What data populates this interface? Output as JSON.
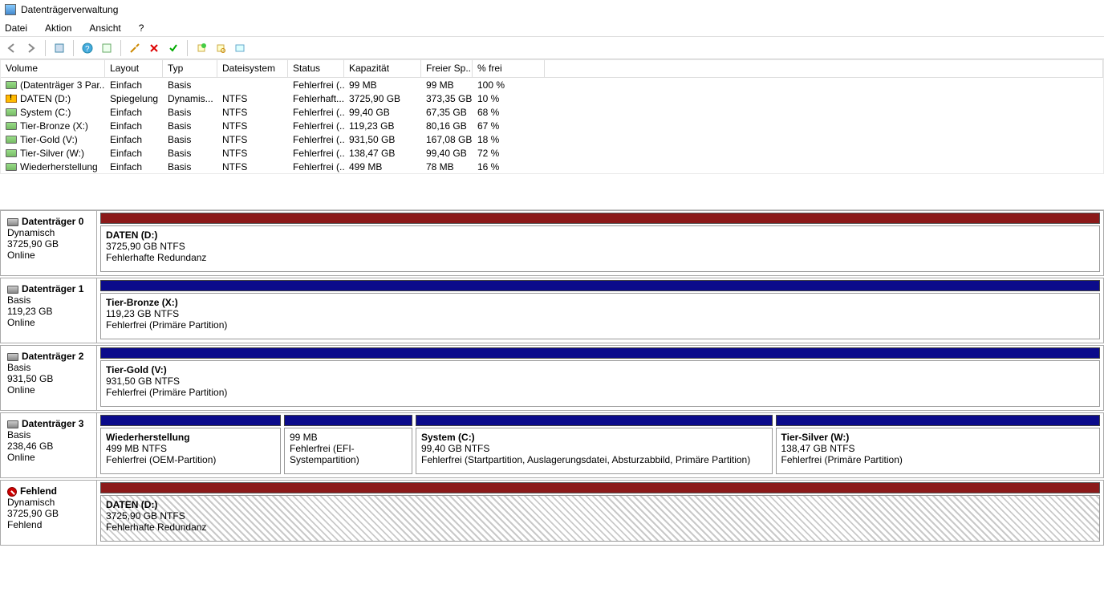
{
  "window": {
    "title": "Datenträgerverwaltung"
  },
  "menu": {
    "file": "Datei",
    "action": "Aktion",
    "view": "Ansicht",
    "help": "?"
  },
  "columns": {
    "volume": "Volume",
    "layout": "Layout",
    "typ": "Typ",
    "fs": "Dateisystem",
    "status": "Status",
    "cap": "Kapazität",
    "free": "Freier Sp...",
    "pct": "% frei"
  },
  "volumes": [
    {
      "name": "(Datenträger 3 Par...",
      "layout": "Einfach",
      "typ": "Basis",
      "fs": "",
      "status": "Fehlerfrei (...",
      "cap": "99 MB",
      "free": "99 MB",
      "pct": "100 %",
      "icon": "ico-vol"
    },
    {
      "name": "DATEN (D:)",
      "layout": "Spiegelung",
      "typ": "Dynamis...",
      "fs": "NTFS",
      "status": "Fehlerhaft...",
      "cap": "3725,90 GB",
      "free": "373,35 GB",
      "pct": "10 %",
      "icon": "ico-warn"
    },
    {
      "name": "System (C:)",
      "layout": "Einfach",
      "typ": "Basis",
      "fs": "NTFS",
      "status": "Fehlerfrei (...",
      "cap": "99,40 GB",
      "free": "67,35 GB",
      "pct": "68 %",
      "icon": "ico-vol"
    },
    {
      "name": "Tier-Bronze (X:)",
      "layout": "Einfach",
      "typ": "Basis",
      "fs": "NTFS",
      "status": "Fehlerfrei (...",
      "cap": "119,23 GB",
      "free": "80,16 GB",
      "pct": "67 %",
      "icon": "ico-vol"
    },
    {
      "name": "Tier-Gold (V:)",
      "layout": "Einfach",
      "typ": "Basis",
      "fs": "NTFS",
      "status": "Fehlerfrei (...",
      "cap": "931,50 GB",
      "free": "167,08 GB",
      "pct": "18 %",
      "icon": "ico-vol"
    },
    {
      "name": "Tier-Silver (W:)",
      "layout": "Einfach",
      "typ": "Basis",
      "fs": "NTFS",
      "status": "Fehlerfrei (...",
      "cap": "138,47 GB",
      "free": "99,40 GB",
      "pct": "72 %",
      "icon": "ico-vol"
    },
    {
      "name": "Wiederherstellung",
      "layout": "Einfach",
      "typ": "Basis",
      "fs": "NTFS",
      "status": "Fehlerfrei (...",
      "cap": "499 MB",
      "free": "78 MB",
      "pct": "16 %",
      "icon": "ico-vol"
    }
  ],
  "disks": [
    {
      "name": "Datenträger 0",
      "type": "Dynamisch",
      "size": "3725,90 GB",
      "status": "Online",
      "band": "band-red",
      "icon": "dico",
      "parts": [
        {
          "title": "DATEN  (D:)",
          "line2": "3725,90 GB NTFS",
          "line3": "Fehlerhafte Redundanz",
          "cls": ""
        }
      ]
    },
    {
      "name": "Datenträger 1",
      "type": "Basis",
      "size": "119,23 GB",
      "status": "Online",
      "band": "band-blue",
      "icon": "dico",
      "parts": [
        {
          "title": "Tier-Bronze  (X:)",
          "line2": "119,23 GB NTFS",
          "line3": "Fehlerfrei (Primäre Partition)",
          "cls": ""
        }
      ]
    },
    {
      "name": "Datenträger 2",
      "type": "Basis",
      "size": "931,50 GB",
      "status": "Online",
      "band": "band-blue",
      "icon": "dico",
      "parts": [
        {
          "title": "Tier-Gold  (V:)",
          "line2": "931,50 GB NTFS",
          "line3": "Fehlerfrei (Primäre Partition)",
          "cls": ""
        }
      ]
    },
    {
      "name": "Datenträger 3",
      "type": "Basis",
      "size": "238,46 GB",
      "status": "Online",
      "band": "band-blue",
      "icon": "dico",
      "parts": [
        {
          "title": "Wiederherstellung",
          "line2": "499 MB NTFS",
          "line3": "Fehlerfrei (OEM-Partition)",
          "cls": "",
          "flex": "0 0 225px"
        },
        {
          "title": "",
          "line2": "99 MB",
          "line3": "Fehlerfrei (EFI-Systempartition)",
          "cls": "",
          "flex": "0 0 160px"
        },
        {
          "title": "System  (C:)",
          "line2": "99,40 GB NTFS",
          "line3": "Fehlerfrei (Startpartition, Auslagerungsdatei, Absturzabbild, Primäre Partition)",
          "cls": "",
          "flex": "1 1 420px"
        },
        {
          "title": "Tier-Silver  (W:)",
          "line2": "138,47 GB NTFS",
          "line3": "Fehlerfrei (Primäre Partition)",
          "cls": "",
          "flex": "1 1 380px"
        }
      ]
    },
    {
      "name": "Fehlend",
      "type": "Dynamisch",
      "size": "3725,90 GB",
      "status": "Fehlend",
      "band": "band-red",
      "icon": "dico-err",
      "parts": [
        {
          "title": "DATEN  (D:)",
          "line2": "3725,90 GB NTFS",
          "line3": "Fehlerhafte Redundanz",
          "cls": "part-hatch"
        }
      ]
    }
  ]
}
